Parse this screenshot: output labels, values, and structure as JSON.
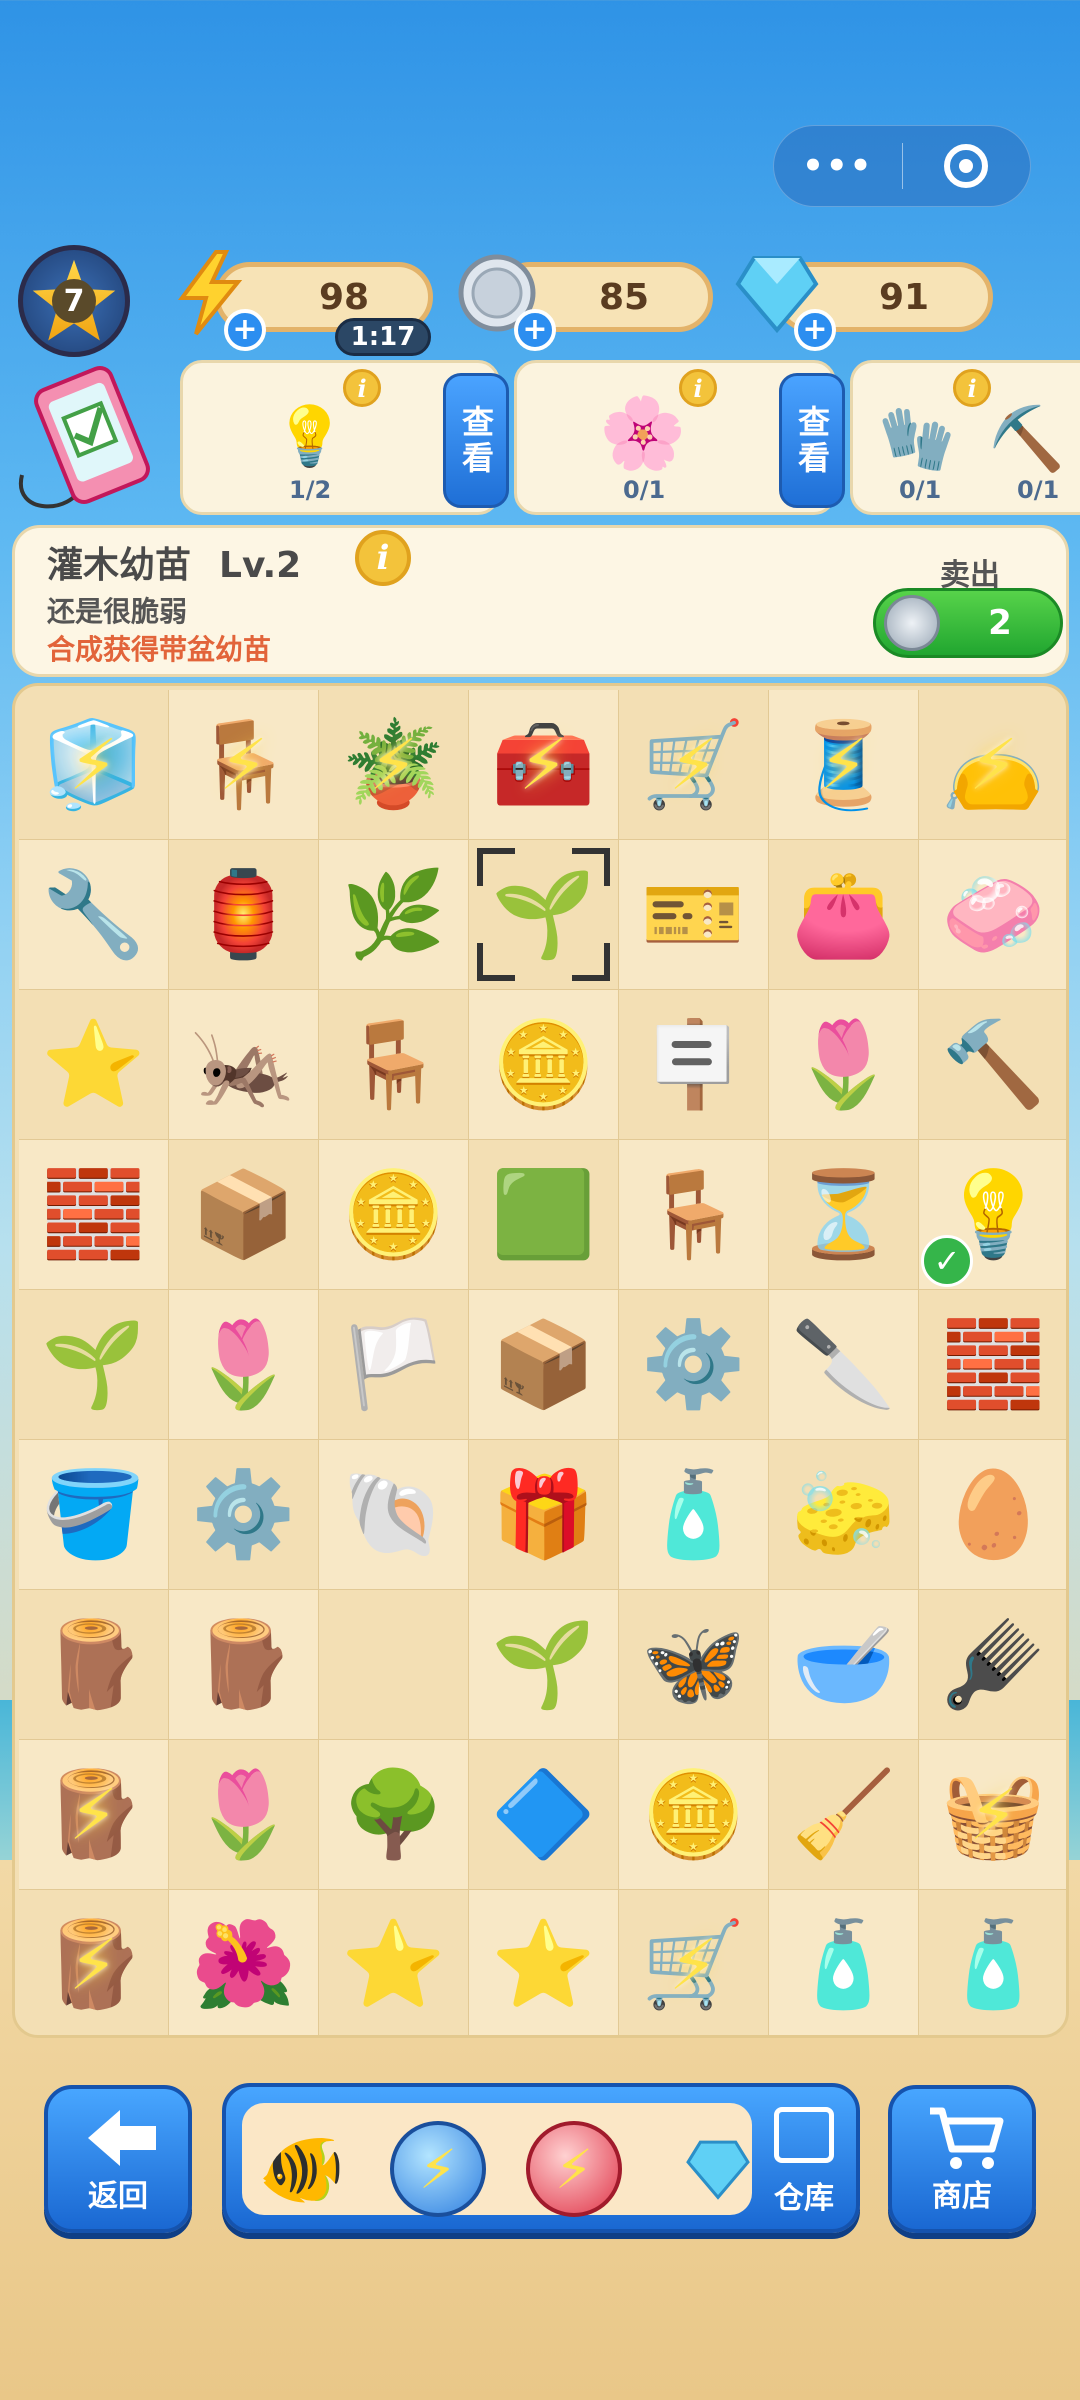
{
  "resources": {
    "level": "7",
    "energy": "98",
    "energy_timer": "1:17",
    "coins": "85",
    "gems": "91"
  },
  "orders": [
    {
      "count": "1/2",
      "view_label": "查看",
      "item": "light-bulb"
    },
    {
      "count": "0/1",
      "view_label": "查看",
      "item": "flower-bush"
    },
    {
      "count_a": "0/1",
      "count_b": "0/1",
      "item_a": "gloves",
      "item_b": "shovel"
    }
  ],
  "info_panel": {
    "name": "灌木幼苗",
    "level": "Lv.2",
    "description": "还是很脆弱",
    "hint": "合成获得带盆幼苗",
    "sell_label": "卖出",
    "sell_price": "2"
  },
  "board": {
    "rows": [
      [
        {
          "name": "cooler-box",
          "e": "🧊",
          "bolt": true
        },
        {
          "name": "wooden-chair",
          "e": "🪑",
          "bolt": true
        },
        {
          "name": "potted-plant",
          "e": "🪴",
          "bolt": true
        },
        {
          "name": "toolbox",
          "e": "🧰",
          "bolt": true
        },
        {
          "name": "cleaning-cart",
          "e": "🛒",
          "bolt": true
        },
        {
          "name": "sewing-machine",
          "e": "🧵",
          "bolt": true
        },
        {
          "name": "sack",
          "e": "👝",
          "bolt": true
        }
      ],
      [
        {
          "name": "wrench",
          "e": "🔧"
        },
        {
          "name": "birdcage",
          "e": "🏮"
        },
        {
          "name": "leaf-sprout",
          "e": "🌿"
        },
        {
          "name": "seedling",
          "e": "🌱",
          "selected": true
        },
        {
          "name": "ticket",
          "e": "🎫"
        },
        {
          "name": "wallet",
          "e": "👛"
        },
        {
          "name": "soap",
          "e": "🧼"
        }
      ],
      [
        {
          "name": "starfish",
          "e": "⭐"
        },
        {
          "name": "moth",
          "e": "🦗"
        },
        {
          "name": "stool",
          "e": "🪑"
        },
        {
          "name": "coin-pile",
          "e": "🪙"
        },
        {
          "name": "signboard",
          "e": "🪧"
        },
        {
          "name": "bud",
          "e": "🌷"
        },
        {
          "name": "pliers",
          "e": "🔨"
        }
      ],
      [
        {
          "name": "bricks",
          "e": "🧱"
        },
        {
          "name": "wooden-crate",
          "e": "📦"
        },
        {
          "name": "coins",
          "e": "🪙"
        },
        {
          "name": "tiles",
          "e": "🟩"
        },
        {
          "name": "round-stool",
          "e": "🪑"
        },
        {
          "name": "hourglass",
          "e": "⏳"
        },
        {
          "name": "light-bulb",
          "e": "💡",
          "check": true
        }
      ],
      [
        {
          "name": "small-sprout",
          "e": "🌱"
        },
        {
          "name": "tulip",
          "e": "🌷"
        },
        {
          "name": "towel",
          "e": "🏳️"
        },
        {
          "name": "open-box",
          "e": "📦"
        },
        {
          "name": "caster-wheel",
          "e": "⚙️"
        },
        {
          "name": "trowel",
          "e": "🔪"
        },
        {
          "name": "cement-bags",
          "e": "🧱"
        }
      ],
      [
        {
          "name": "paint-bucket",
          "e": "🪣"
        },
        {
          "name": "pulley",
          "e": "⚙️"
        },
        {
          "name": "conch-shell",
          "e": "🐚"
        },
        {
          "name": "music-box",
          "e": "🎁"
        },
        {
          "name": "hand-soap",
          "e": "🧴"
        },
        {
          "name": "sponge",
          "e": "🧽"
        },
        {
          "name": "egg-tray",
          "e": "🥚"
        }
      ],
      [
        {
          "name": "logs",
          "e": "🪵"
        },
        {
          "name": "stacked-logs",
          "e": "🪵"
        },
        {
          "name": "empty-cell",
          "e": ""
        },
        {
          "name": "seedling-soil",
          "e": "🌱"
        },
        {
          "name": "blue-moth",
          "e": "🦋"
        },
        {
          "name": "basin",
          "e": "🥣"
        },
        {
          "name": "brush",
          "e": "🪮"
        }
      ],
      [
        {
          "name": "log-bundle",
          "e": "🪵",
          "bolt": true
        },
        {
          "name": "red-flower",
          "e": "🌷"
        },
        {
          "name": "green-bush",
          "e": "🌳"
        },
        {
          "name": "crystal-shard",
          "e": "🔷"
        },
        {
          "name": "silver-coins",
          "e": "🪙"
        },
        {
          "name": "dustpan",
          "e": "🧹"
        },
        {
          "name": "wooden-cage",
          "e": "🧺",
          "bolt": true
        }
      ],
      [
        {
          "name": "log-bundle",
          "e": "🪵",
          "bolt": true
        },
        {
          "name": "flower-plant",
          "e": "🌺"
        },
        {
          "name": "blue-star",
          "e": "⭐"
        },
        {
          "name": "blue-starfish",
          "e": "⭐"
        },
        {
          "name": "mop-cart",
          "e": "🛒",
          "bolt": true
        },
        {
          "name": "spray-bottle",
          "e": "🧴"
        },
        {
          "name": "detergent",
          "e": "🧴"
        }
      ]
    ]
  },
  "bottom_bar": {
    "back_label": "返回",
    "warehouse_label": "仓库",
    "shop_label": "商店"
  }
}
